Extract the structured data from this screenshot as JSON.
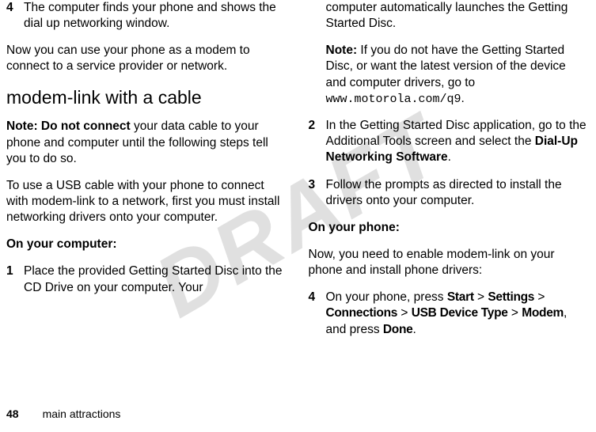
{
  "watermark": "DRAFT",
  "left": {
    "step4": {
      "num": "4",
      "text": "The computer finds your phone and shows the dial up networking window."
    },
    "p1": "Now you can use your phone as a modem to connect to a service provider or network.",
    "subhead": "modem-link with a cable",
    "note": {
      "prefix": "Note: Do not connect",
      "rest": " your data cable to your phone and computer until the following steps tell you to do so."
    },
    "p2": "To use a USB cable with your phone to connect with modem-link to a network, first you must install networking drivers onto your computer.",
    "heading1": "On your computer:",
    "step1": {
      "num": "1",
      "text": "Place the provided Getting Started Disc into the CD Drive on your computer. Your"
    }
  },
  "right": {
    "cont1": "computer automatically launches the Getting Started Disc.",
    "note2": {
      "prefix": "Note:",
      "rest": " If you do not have the Getting Started Disc, or want the latest version of the device and computer drivers, go to ",
      "url": "www.motorola.com/q9",
      "period": "."
    },
    "step2": {
      "num": "2",
      "part1": "In the Getting Started Disc application, go to the Additional Tools screen and select the ",
      "boldpart": "Dial-Up Networking Software",
      "period": "."
    },
    "step3": {
      "num": "3",
      "text": "Follow the prompts as directed to install the drivers onto your computer."
    },
    "heading2": "On your phone:",
    "p3": "Now, you need to enable modem-link on your phone and install phone drivers:",
    "step4b": {
      "num": "4",
      "part1": "On your phone, press ",
      "b1": "Start",
      "gt1": " > ",
      "b2": "Settings",
      "gt2": " > ",
      "b3": "Connections",
      "gt3": " > ",
      "b4": "USB Device Type",
      "gt4": " > ",
      "b5": "Modem",
      "mid": ", and press ",
      "b6": "Done",
      "period": "."
    }
  },
  "footer": {
    "page": "48",
    "section": "main attractions"
  }
}
